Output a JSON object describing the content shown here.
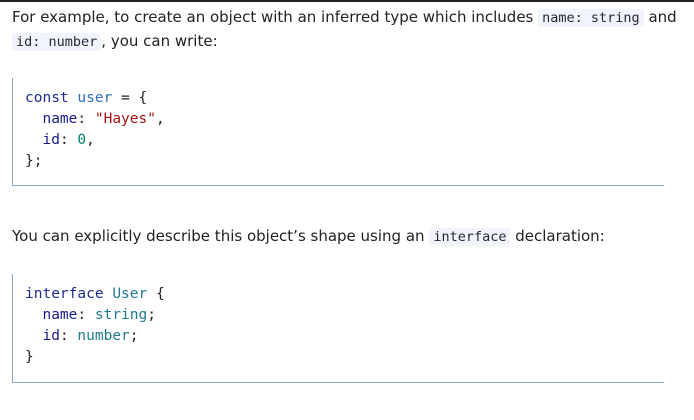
{
  "paragraph1": {
    "before": "For example, to create an object with an inferred type which includes ",
    "code1": "name: string",
    "middle": " and ",
    "code2": "id: number",
    "after": ", you can write:"
  },
  "code_block1": {
    "kw_const": "const",
    "var_user": "user",
    "op_eq": " = {",
    "prop_name": "name",
    "colon1": ": ",
    "str_hayes": "\"Hayes\"",
    "comma1": ",",
    "prop_id": "id",
    "colon2": ": ",
    "num_zero": "0",
    "comma2": ",",
    "close": "};"
  },
  "paragraph2": {
    "before": "You can explicitly describe this object’s shape using an ",
    "code": "interface",
    "after": " declaration:"
  },
  "code_block2": {
    "kw_interface": "interface",
    "type_user": "User",
    "open": " {",
    "prop_name": "name",
    "colon1": ": ",
    "type_string": "string",
    "semi1": ";",
    "prop_id": "id",
    "colon2": ": ",
    "type_number": "number",
    "semi2": ";",
    "close": "}"
  }
}
